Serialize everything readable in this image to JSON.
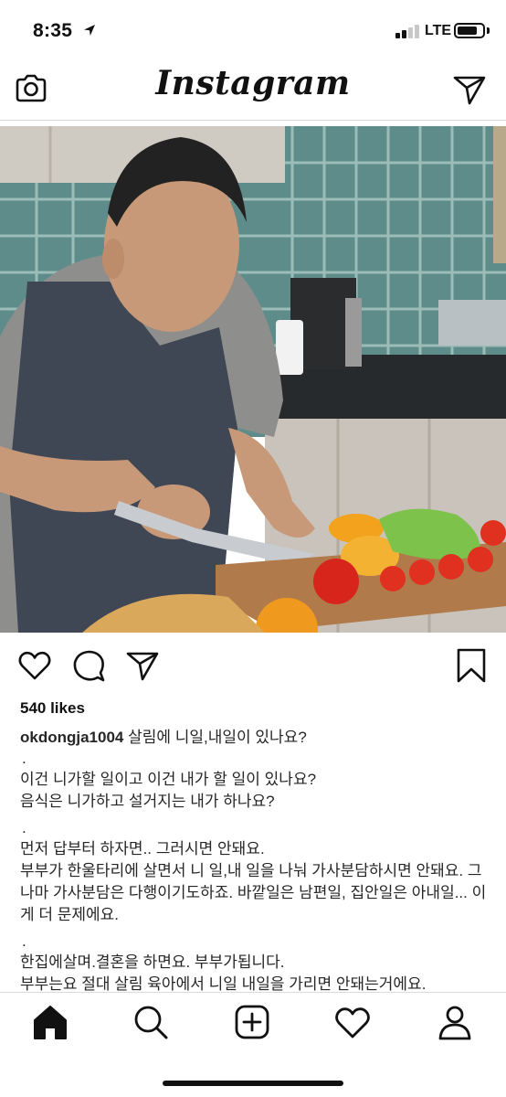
{
  "status_bar": {
    "time": "8:35",
    "network": "LTE"
  },
  "header": {
    "logo_text": "Instagram",
    "left_icon": "camera-icon",
    "right_icon": "direct-message-icon"
  },
  "post": {
    "image_alt_icon": "post-photo",
    "actions": {
      "like_icon": "heart-icon",
      "comment_icon": "comment-icon",
      "share_icon": "share-icon",
      "save_icon": "bookmark-icon"
    },
    "likes_text": "540 likes",
    "username": "okdongja1004",
    "caption_first": "살림에 니일,내일이 있나요?",
    "dot": ".",
    "caption_line_2": "이건 니가할 일이고 이건 내가 할 일이 있나요?",
    "caption_line_3": "음식은 니가하고 설거지는 내가 하나요?",
    "caption_line_4": "먼저 답부터 하자면.. 그러시면 안돼요.",
    "caption_line_5": "부부가 한울타리에 살면서 니 일,내 일을 나눠 가사분담하시면 안돼요. 그나마 가사분담은 다행이기도하죠. 바깥일은 남편일, 집안일은 아내일... 이게 더 문제에요.",
    "caption_line_6": "한집에살며.결혼을 하면요. 부부가됩니다.",
    "caption_line_7": "부부는요 절대 살림 육아에서 니일 내일을 가리면 안돼는거에요."
  },
  "bottom_nav": {
    "items": [
      "home-icon",
      "search-icon",
      "new-post-icon",
      "activity-icon",
      "profile-icon"
    ]
  },
  "colors": {
    "text": "#262626",
    "divider": "#dbdbdb",
    "background": "#ffffff"
  }
}
